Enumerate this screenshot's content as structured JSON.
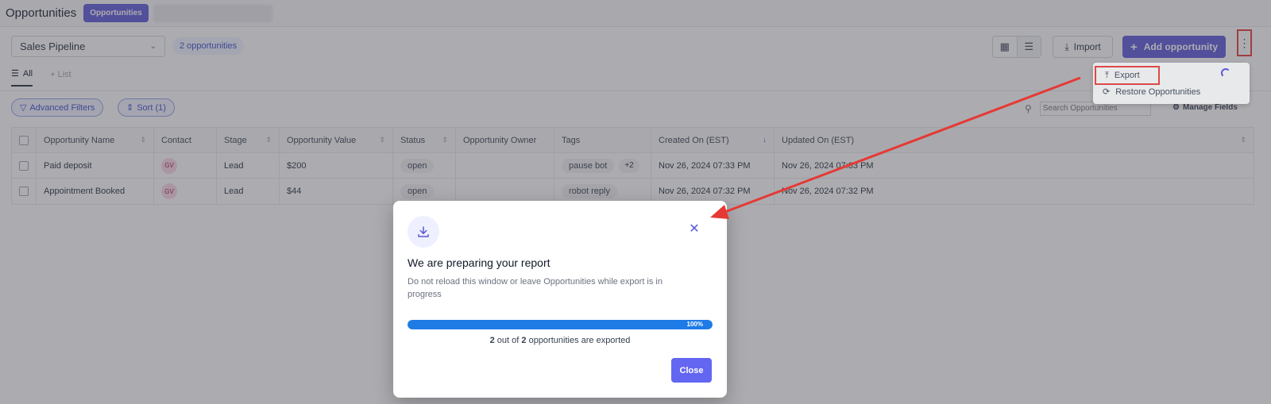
{
  "header": {
    "title": "Opportunities",
    "active_tab": "Opportunities"
  },
  "toolbar": {
    "pipeline": "Sales Pipeline",
    "count_badge": "2 opportunities",
    "import_label": "Import",
    "add_label": "Add opportunity"
  },
  "subtabs": {
    "all": "All",
    "list": "List"
  },
  "filters": {
    "advanced": "Advanced Filters",
    "sort": "Sort (1)"
  },
  "search": {
    "placeholder": "Search Opportunities"
  },
  "manage_fields": "Manage Fields",
  "table": {
    "headers": [
      "Opportunity Name",
      "Contact",
      "Stage",
      "Opportunity Value",
      "Status",
      "Opportunity Owner",
      "Tags",
      "Created On (EST)",
      "Updated On (EST)"
    ],
    "rows": [
      {
        "name": "Paid deposit",
        "contact": "GV",
        "stage": "Lead",
        "value": "$200",
        "status": "open",
        "owner": "",
        "tags": [
          "pause bot"
        ],
        "more_tags": "+2",
        "created": "Nov 26, 2024 07:33 PM",
        "updated": "Nov 26, 2024 07:33 PM"
      },
      {
        "name": "Appointment Booked",
        "contact": "GV",
        "stage": "Lead",
        "value": "$44",
        "status": "open",
        "owner": "",
        "tags": [
          "robot reply"
        ],
        "more_tags": "",
        "created": "Nov 26, 2024 07:32 PM",
        "updated": "Nov 26, 2024 07:32 PM"
      }
    ]
  },
  "dropdown": {
    "export": "Export",
    "restore": "Restore Opportunities"
  },
  "modal": {
    "title": "We are preparing your report",
    "description": "Do not reload this window or leave Opportunities while export is in progress",
    "progress_percent": 100,
    "progress_label": "100%",
    "exported": "2",
    "total": "2",
    "progress_suffix": "opportunities are exported",
    "out_of": "out of",
    "close_label": "Close"
  },
  "colors": {
    "accent": "#5b57d9",
    "progress": "#1e7be6",
    "annotation": "#e53935"
  }
}
